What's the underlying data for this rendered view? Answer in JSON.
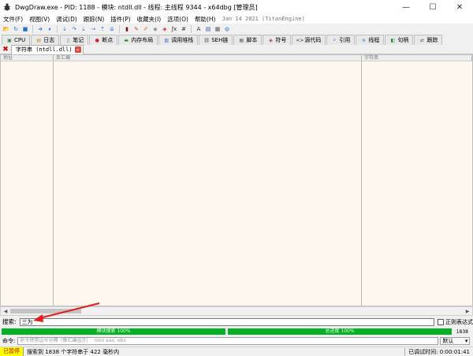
{
  "window": {
    "title": "DwgDraw.exe - PID: 1188 - 模块: ntdll.dll - 线程: 主线程 9344 - x64dbg [管理员]",
    "minimize_glyph": "—",
    "maximize_glyph": "☐",
    "close_glyph": "✕"
  },
  "menu": {
    "items": [
      "文件(F)",
      "视图(V)",
      "调试(D)",
      "跟踪(N)",
      "插件(P)",
      "收藏夹(I)",
      "选项(O)",
      "帮助(H)"
    ],
    "build_date": "Jan 14 2021 (TitanEngine)"
  },
  "toolbar": {
    "icons": [
      {
        "name": "open-icon",
        "glyph": "📂",
        "color": "#d9a520"
      },
      {
        "name": "restart-icon",
        "glyph": "↻",
        "color": "#2a6fd6"
      },
      {
        "name": "close-debuggee-icon",
        "glyph": "■",
        "color": "#2a6fd6"
      },
      {
        "name": "run-icon",
        "glyph": "➜",
        "color": "#2a6fd6"
      },
      {
        "name": "pause-icon",
        "glyph": "⏸",
        "color": "#2a6fd6"
      },
      {
        "name": "step-into-icon",
        "glyph": "↓",
        "color": "#2a6fd6"
      },
      {
        "name": "step-over-icon",
        "glyph": "↷",
        "color": "#2a6fd6"
      },
      {
        "name": "trace-into-icon",
        "glyph": "⇣",
        "color": "#2a6fd6"
      },
      {
        "name": "trace-over-icon",
        "glyph": "⇢",
        "color": "#2a6fd6"
      },
      {
        "name": "execute-till-return-icon",
        "glyph": "⇡",
        "color": "#2a6fd6"
      },
      {
        "name": "run-to-user-code-icon",
        "glyph": "⇊",
        "color": "#2a6fd6"
      },
      {
        "name": "scylla-icon",
        "glyph": "▮",
        "color": "#7a1010"
      },
      {
        "name": "patch-icon",
        "glyph": "✎",
        "color": "#c05020"
      },
      {
        "name": "comment-icon",
        "glyph": "✐",
        "color": "#d08020"
      },
      {
        "name": "label-icon",
        "glyph": "◆",
        "color": "#9a9a9a"
      },
      {
        "name": "bookmark-icon",
        "glyph": "◈",
        "color": "#c03030"
      },
      {
        "name": "function-icon",
        "glyph": "ƒx",
        "color": "#333333"
      },
      {
        "name": "hash-icon",
        "glyph": "#",
        "color": "#333333"
      },
      {
        "name": "font-icon",
        "glyph": "A",
        "color": "#333333"
      },
      {
        "name": "script-icon",
        "glyph": "▤",
        "color": "#3060a0"
      },
      {
        "name": "calculator-icon",
        "glyph": "▦",
        "color": "#555555"
      },
      {
        "name": "globe-icon",
        "glyph": "◍",
        "color": "#2a8ad6"
      }
    ]
  },
  "tabs": [
    {
      "name": "tab-cpu",
      "icon": "cpu-icon",
      "glyph": "▣",
      "color": "#3a7a3a",
      "label": "CPU"
    },
    {
      "name": "tab-log",
      "icon": "log-icon",
      "glyph": "▤",
      "color": "#d09030",
      "label": "日志"
    },
    {
      "name": "tab-notes",
      "icon": "notes-icon",
      "glyph": "▯",
      "color": "#707070",
      "label": "笔记"
    },
    {
      "name": "tab-breakpoints",
      "icon": "breakpoint-icon",
      "glyph": "●",
      "color": "#d02020",
      "label": "断点"
    },
    {
      "name": "tab-memory-map",
      "icon": "memory-map-icon",
      "glyph": "▬",
      "color": "#2a8a2a",
      "label": "内存布局"
    },
    {
      "name": "tab-call-stack",
      "icon": "call-stack-icon",
      "glyph": "▥",
      "color": "#2a6fd6",
      "label": "调用堆栈"
    },
    {
      "name": "tab-seh",
      "icon": "seh-icon",
      "glyph": "⛓",
      "color": "#606060",
      "label": "SEH链"
    },
    {
      "name": "tab-script",
      "icon": "script-icon",
      "glyph": "▤",
      "color": "#404040",
      "label": "脚本"
    },
    {
      "name": "tab-symbols",
      "icon": "symbols-icon",
      "glyph": "◈",
      "color": "#a03060",
      "label": "符号"
    },
    {
      "name": "tab-source",
      "icon": "source-icon",
      "glyph": "<>",
      "color": "#303030",
      "label": "源代码"
    },
    {
      "name": "tab-references",
      "icon": "references-icon",
      "glyph": "⌕",
      "color": "#2a6fd6",
      "label": "引用"
    },
    {
      "name": "tab-threads",
      "icon": "threads-icon",
      "glyph": "≋",
      "color": "#2a6fd6",
      "label": "线程"
    },
    {
      "name": "tab-handles",
      "icon": "handles-icon",
      "glyph": "◧",
      "color": "#2a8a2a",
      "label": "句柄"
    },
    {
      "name": "tab-trace",
      "icon": "trace-icon",
      "glyph": "⇄",
      "color": "#606060",
      "label": "跟踪"
    }
  ],
  "subtab": {
    "close_all_glyph": "✖",
    "label": "字符串 (ntdll.dll)",
    "close_glyph": "✕"
  },
  "table": {
    "columns": [
      "地址",
      "反汇编",
      "字符串"
    ]
  },
  "scrollbar": {
    "left_glyph": "◀",
    "right_glyph": "▶"
  },
  "search": {
    "label": "搜索:",
    "value": "三为",
    "regex_label": "正则表达式"
  },
  "progress": {
    "module_label": "模块搜索 100%",
    "total_label": "总进度 100%",
    "module_fraction": 1.0,
    "total_fraction": 1.0,
    "count": "1838"
  },
  "command": {
    "label": "命令:",
    "placeholder": "命令使用逗号分隔（像汇编语言）: mov eax, ebx",
    "mode": "默认",
    "mode_arrow": "▾"
  },
  "status": {
    "state": "已暂停",
    "message": "搜索到 1838 个字符串于 422 毫秒内",
    "elapsed": "已调试时间: 0:00:01:41"
  },
  "colors": {
    "accent_green": "#06b025",
    "paused_bg": "#ffff00",
    "paused_fg": "#c00000",
    "annotation_red": "#e02020"
  }
}
